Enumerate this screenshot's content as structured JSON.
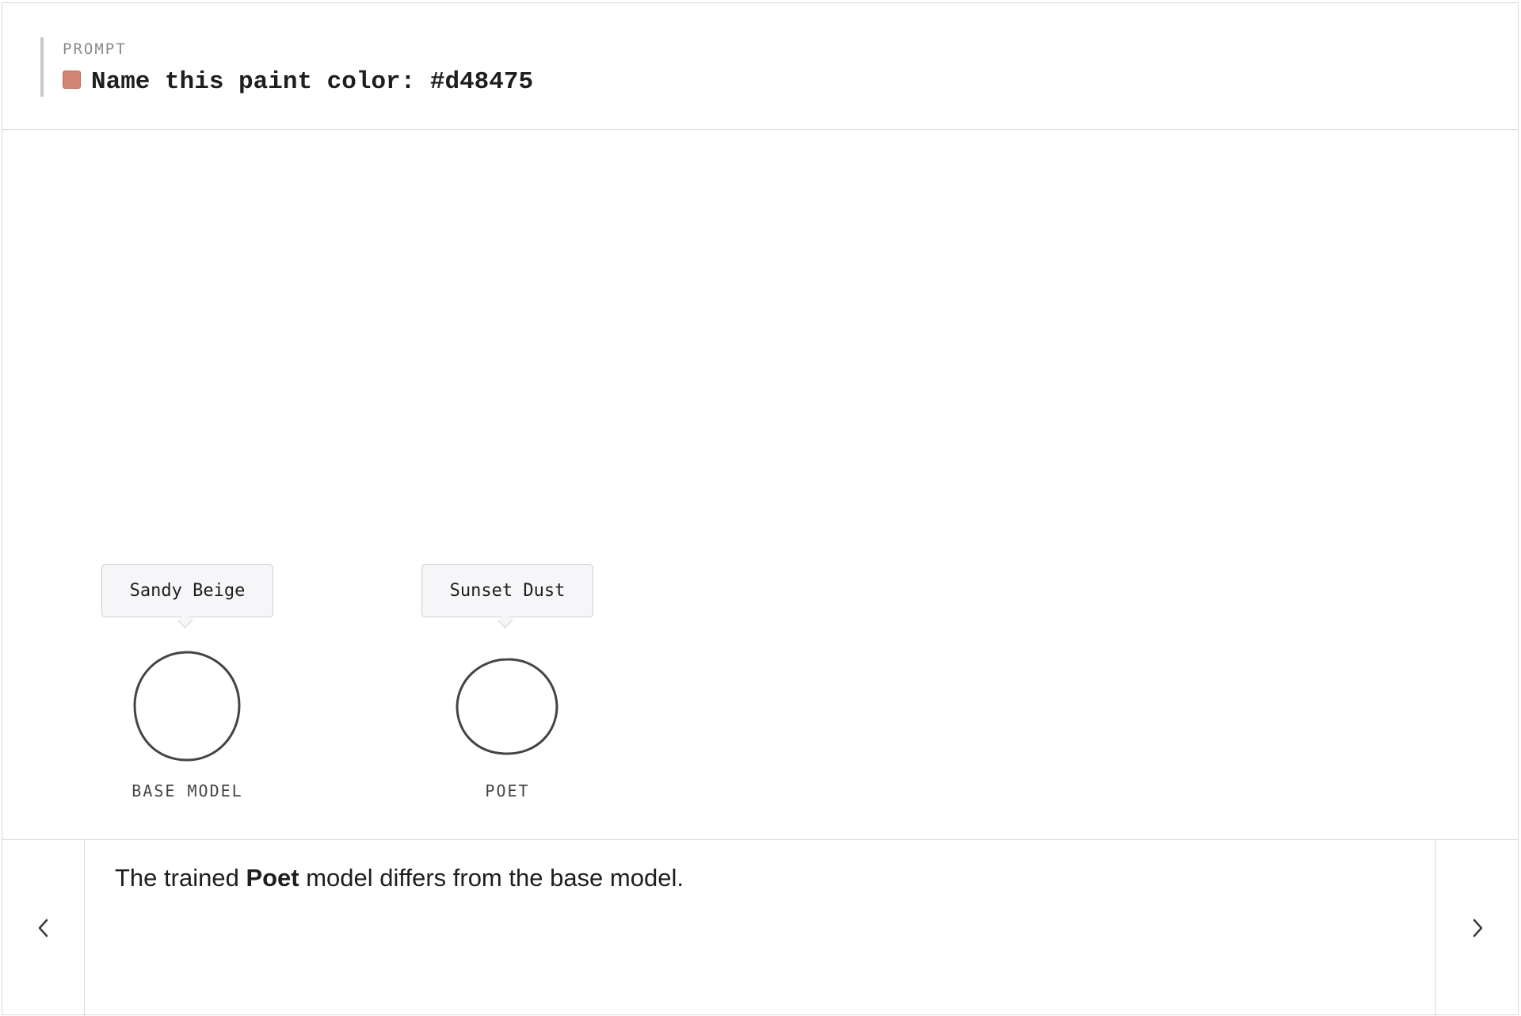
{
  "prompt": {
    "label": "PROMPT",
    "text": "Name this paint color: #d48475",
    "swatch_color": "#d48475"
  },
  "models": [
    {
      "name": "BASE MODEL",
      "answer": "Sandy Beige",
      "icon": "circle-outline-icon"
    },
    {
      "name": "POET",
      "answer": "Sunset Dust",
      "icon": "circle-outline-icon"
    }
  ],
  "caption": {
    "before": "The trained ",
    "highlight": "Poet",
    "after": " model differs from the base model."
  },
  "nav": {
    "prev_icon": "chevron-left-icon",
    "next_icon": "chevron-right-icon"
  }
}
